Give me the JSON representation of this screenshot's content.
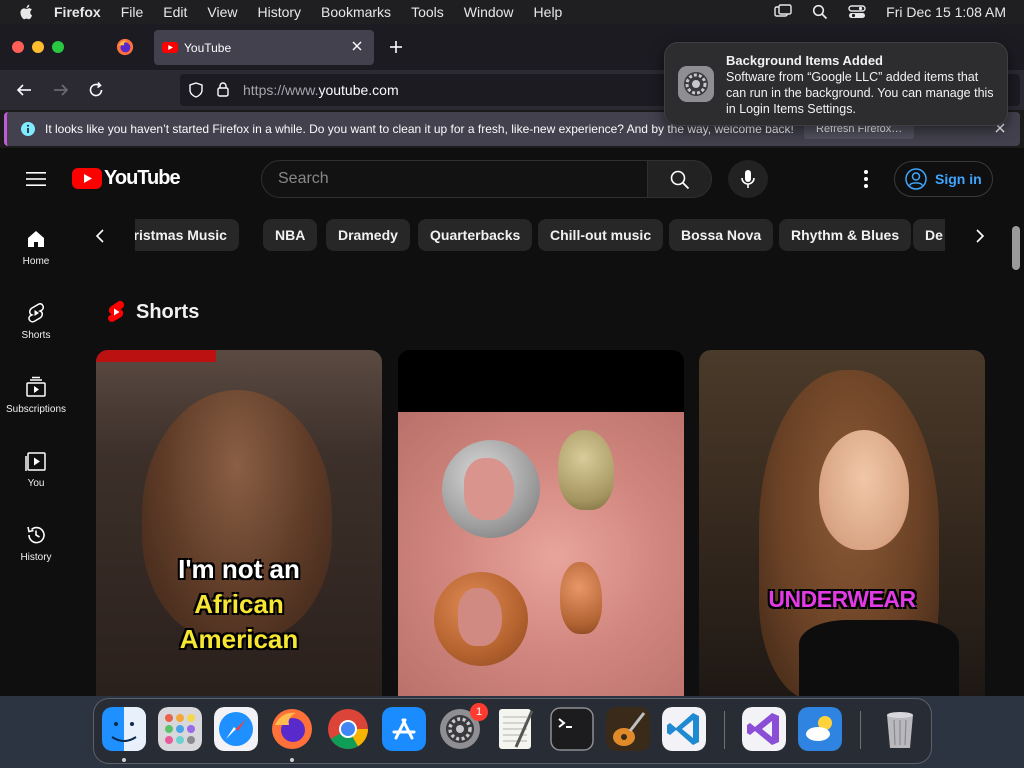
{
  "menubar": {
    "app_name": "Firefox",
    "items": [
      "File",
      "Edit",
      "View",
      "History",
      "Bookmarks",
      "Tools",
      "Window",
      "Help"
    ],
    "datetime": "Fri Dec 15  1:08 AM"
  },
  "browser": {
    "tab_title": "YouTube",
    "url_prefix": "https://www.",
    "url_domain": "youtube.com",
    "infobar_text": "It looks like you haven’t started Firefox in a while. Do you want to clean it up for a fresh, like-new experience? And by the way, welcome back!",
    "infobar_button": "Refresh Firefox…"
  },
  "notification": {
    "title": "Background Items Added",
    "body": "Software from “Google LLC” added items that can run in the background. You can manage this in Login Items Settings."
  },
  "youtube": {
    "logo_text": "YouTube",
    "search_placeholder": "Search",
    "signin_label": "Sign in",
    "guide": [
      {
        "label": "Home",
        "icon": "home-icon"
      },
      {
        "label": "Shorts",
        "icon": "shorts-icon"
      },
      {
        "label": "Subscriptions",
        "icon": "subscriptions-icon"
      },
      {
        "label": "You",
        "icon": "you-icon"
      },
      {
        "label": "History",
        "icon": "history-icon"
      }
    ],
    "chips": [
      "hristmas Music",
      "NBA",
      "Dramedy",
      "Quarterbacks",
      "Chill-out music",
      "Bossa Nova",
      "Rhythm & Blues",
      "De"
    ],
    "shorts_title": "Shorts",
    "shorts": [
      {
        "caption_line1": "I'm not an",
        "caption_line2": "African",
        "caption_line3": "American"
      },
      {
        "caption": ""
      },
      {
        "caption": "UNDERWEAR"
      }
    ]
  },
  "dock": {
    "apps": [
      "Finder",
      "Launchpad",
      "Safari",
      "Firefox",
      "Chrome",
      "App Store",
      "System Settings",
      "TextEdit",
      "Terminal",
      "GarageBand",
      "Visual Studio Code",
      "Visual Studio",
      "Weather",
      "Trash"
    ],
    "settings_badge": "1"
  },
  "colors": {
    "yt_red": "#ff0000",
    "link_blue": "#3ea6ff",
    "firefox_tab": "#42414d"
  }
}
